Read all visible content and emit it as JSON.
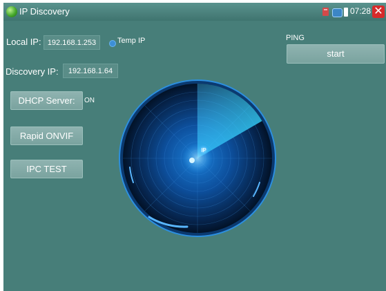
{
  "titlebar": {
    "title": "IP Discovery",
    "time": "07:28",
    "close_symbol": "✕"
  },
  "form": {
    "local_ip_label": "Local IP:",
    "local_ip_value": "192.168.1.253",
    "temp_ip_label": "Temp IP",
    "discovery_ip_label": "Discovery IP:",
    "discovery_ip_value": "192.168.1.64"
  },
  "ping": {
    "label": "PING",
    "start_label": "start"
  },
  "buttons": {
    "dhcp_label": "DHCP Server:",
    "dhcp_state": "ON",
    "onvif_label": "Rapid ONVIF",
    "ipc_test_label": "IPC TEST"
  },
  "radar": {
    "center_label": "IP"
  },
  "colors": {
    "background": "#477e79",
    "accent_blue": "#1fa8ff",
    "close_red": "#d62b2b"
  }
}
